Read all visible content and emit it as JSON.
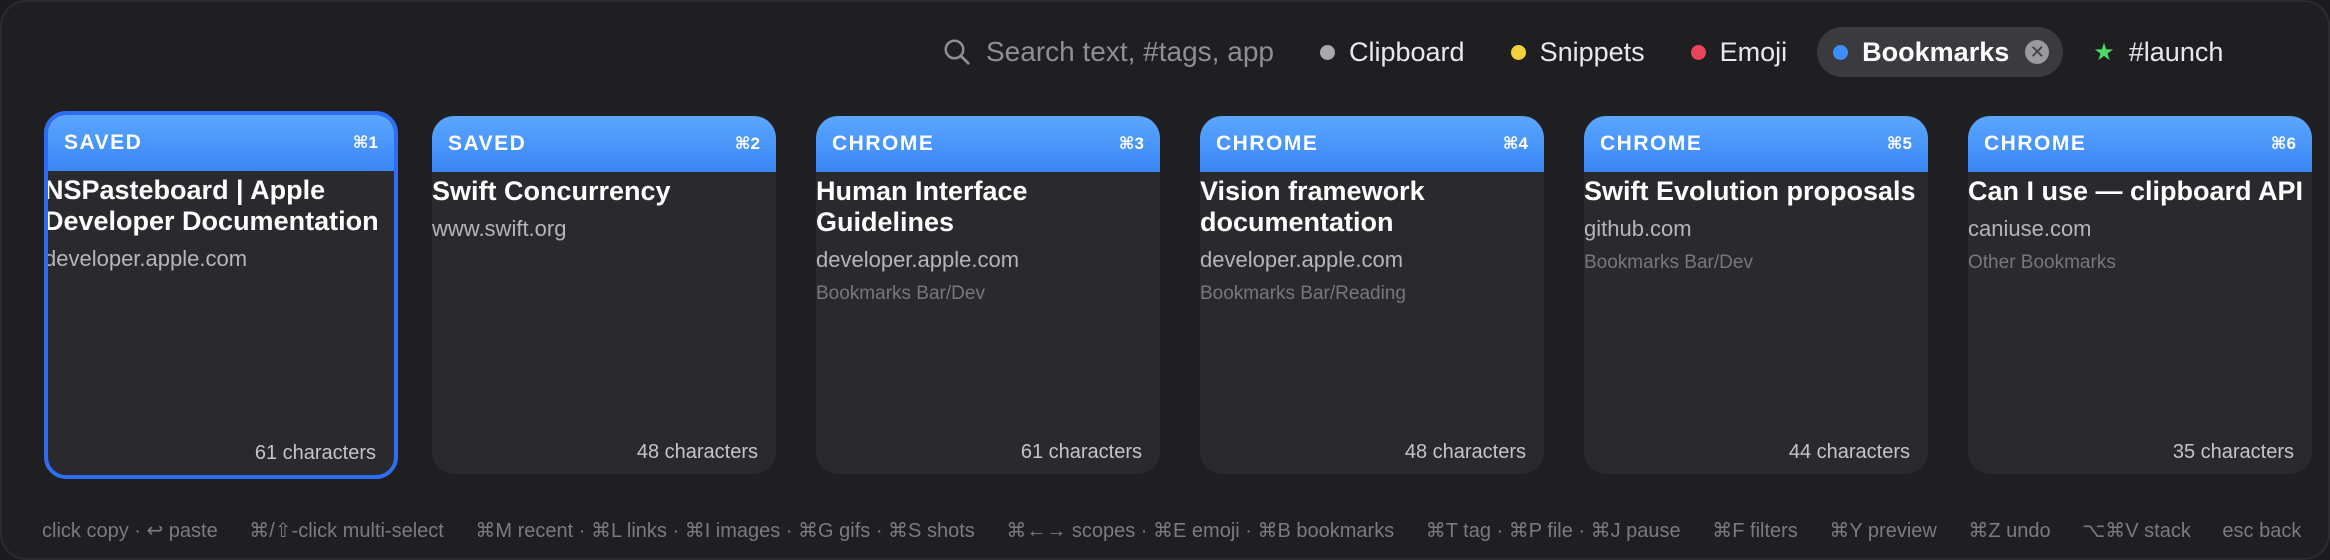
{
  "search": {
    "placeholder": "Search text, #tags, app"
  },
  "filters": [
    {
      "label": "Clipboard",
      "color": "#a8a8ad"
    },
    {
      "label": "Snippets",
      "color": "#f2d13c"
    },
    {
      "label": "Emoji",
      "color": "#e8445a"
    },
    {
      "label": "Bookmarks",
      "color": "#3d8ef8",
      "active": true
    },
    {
      "label": "#launch",
      "color": "#4cd964"
    }
  ],
  "accent": "#3b86f5",
  "cards": [
    {
      "source": "SAVED",
      "shortcut": "⌘1",
      "title": "NSPasteboard | Apple Developer Documentation",
      "url": "developer.apple.com",
      "folder": "",
      "count": "61 characters"
    },
    {
      "source": "SAVED",
      "shortcut": "⌘2",
      "title": "Swift Concurrency",
      "url": "www.swift.org",
      "folder": "",
      "count": "48 characters"
    },
    {
      "source": "CHROME",
      "shortcut": "⌘3",
      "title": "Human Interface Guidelines",
      "url": "developer.apple.com",
      "folder": "Bookmarks Bar/Dev",
      "count": "61 characters"
    },
    {
      "source": "CHROME",
      "shortcut": "⌘4",
      "title": "Vision framework documentation",
      "url": "developer.apple.com",
      "folder": "Bookmarks Bar/Reading",
      "count": "48 characters"
    },
    {
      "source": "CHROME",
      "shortcut": "⌘5",
      "title": "Swift Evolution proposals",
      "url": "github.com",
      "folder": "Bookmarks Bar/Dev",
      "count": "44 characters"
    },
    {
      "source": "CHROME",
      "shortcut": "⌘6",
      "title": "Can I use — clipboard API",
      "url": "caniuse.com",
      "folder": "Other Bookmarks",
      "count": "35 characters"
    }
  ],
  "footer": [
    "click copy · ↩ paste",
    "⌘/⇧-click multi-select",
    "⌘M recent · ⌘L links · ⌘I images · ⌘G gifs · ⌘S shots",
    "⌘←→ scopes · ⌘E emoji · ⌘B bookmarks",
    "⌘T tag · ⌘P file · ⌘J pause",
    "⌘F filters",
    "⌘Y preview",
    "⌘Z undo",
    "⌥⌘V stack",
    "esc back"
  ]
}
